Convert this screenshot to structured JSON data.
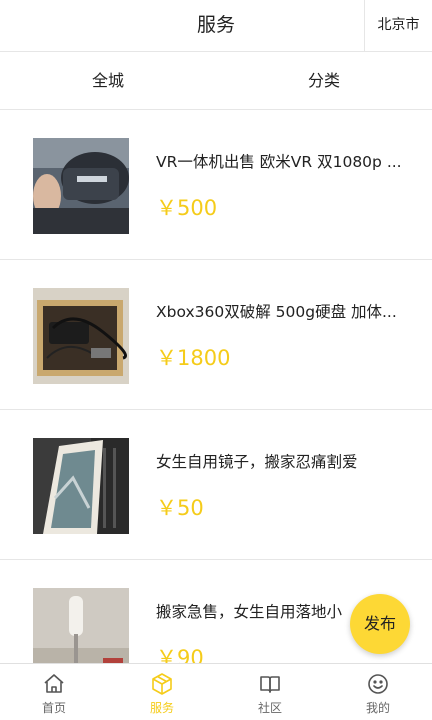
{
  "header": {
    "title": "服务",
    "city": "北京市"
  },
  "filters": [
    {
      "label": "全城"
    },
    {
      "label": "分类"
    }
  ],
  "listings": [
    {
      "title": "VR一体机出售 欧米VR 双1080p ...",
      "price": "￥500",
      "image": "vr-headset-photo"
    },
    {
      "title": "Xbox360双破解 500g硬盘 加体...",
      "price": "￥1800",
      "image": "xbox-console-photo"
    },
    {
      "title": "女生自用镜子，搬家忍痛割爱",
      "price": "￥50",
      "image": "mirror-photo"
    },
    {
      "title": "搬家急售，女生自用落地小",
      "price": "￥90",
      "image": "floor-lamp-photo"
    }
  ],
  "fab": {
    "label": "发布"
  },
  "tabbar": [
    {
      "label": "首页",
      "icon": "home-icon",
      "active": false
    },
    {
      "label": "服务",
      "icon": "box-icon",
      "active": true
    },
    {
      "label": "社区",
      "icon": "book-icon",
      "active": false
    },
    {
      "label": "我的",
      "icon": "smile-icon",
      "active": false
    }
  ],
  "colors": {
    "accent": "#fdd835",
    "price": "#f5cc1a",
    "divider": "#e6e6e6"
  }
}
